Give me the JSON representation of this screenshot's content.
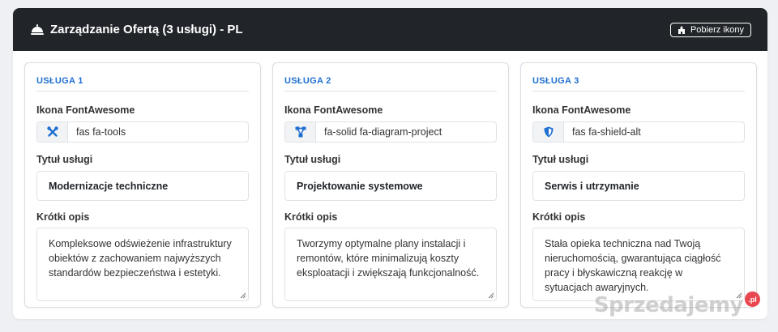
{
  "header": {
    "title": "Zarządzanie Ofertą (3 usługi) - PL",
    "download_button": "Pobierz ikony"
  },
  "labels": {
    "icon": "Ikona FontAwesome",
    "title": "Tytuł usługi",
    "description": "Krótki opis"
  },
  "services": [
    {
      "label": "USŁUGA 1",
      "icon_name": "tools-icon",
      "icon_class": "fas fa-tools",
      "title": "Modernizacje techniczne",
      "description": "Kompleksowe odświeżenie infrastruktury obiektów z zachowaniem najwyższych standardów bezpieczeństwa i estetyki."
    },
    {
      "label": "USŁUGA 2",
      "icon_name": "diagram-project-icon",
      "icon_class": "fa-solid fa-diagram-project",
      "title": "Projektowanie systemowe",
      "description": "Tworzymy optymalne plany instalacji i remontów, które minimalizują koszty eksploatacji i zwiększają funkcjonalność."
    },
    {
      "label": "USŁUGA 3",
      "icon_name": "shield-alt-icon",
      "icon_class": "fas fa-shield-alt",
      "title": "Serwis i utrzymanie",
      "description": "Stała opieka techniczna nad Twoją nieruchomością, gwarantująca ciągłość pracy i błyskawiczną reakcję w sytuacjach awaryjnych."
    }
  ],
  "watermark": {
    "text": "Sprzedajemy",
    "badge": ".pl"
  },
  "colors": {
    "header_bg": "#212529",
    "accent": "#1f6fd1"
  }
}
